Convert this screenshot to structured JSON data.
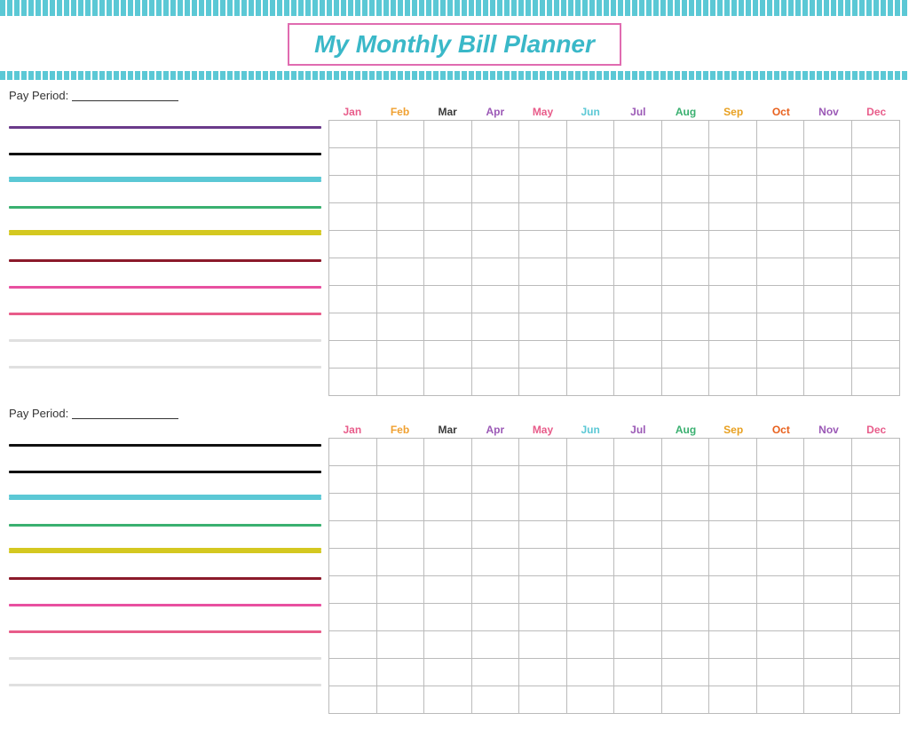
{
  "title": "My Monthly Bill Planner",
  "topBar": {
    "color": "#5bc8d5"
  },
  "months": [
    {
      "label": "Jan",
      "class": "m-jan"
    },
    {
      "label": "Feb",
      "class": "m-feb"
    },
    {
      "label": "Mar",
      "class": "m-mar"
    },
    {
      "label": "Apr",
      "class": "m-apr"
    },
    {
      "label": "May",
      "class": "m-may"
    },
    {
      "label": "Jun",
      "class": "m-jun"
    },
    {
      "label": "Jul",
      "class": "m-jul"
    },
    {
      "label": "Aug",
      "class": "m-aug"
    },
    {
      "label": "Sep",
      "class": "m-sep"
    },
    {
      "label": "Oct",
      "class": "m-oct"
    },
    {
      "label": "Nov",
      "class": "m-nov"
    },
    {
      "label": "Dec",
      "class": "m-dec"
    }
  ],
  "section1": {
    "payPeriodLabel": "Pay Period:",
    "rows": 10,
    "lineColors": [
      [
        "#6a3a8a"
      ],
      [
        "#111"
      ],
      [
        "#5bc8d5",
        "#5bc8d5"
      ],
      [
        "#3ab070"
      ],
      [
        "#d4c820",
        "#d4c820"
      ],
      [
        "#8b1a2a"
      ],
      [
        "#e850a0"
      ],
      [
        "#e85c8a"
      ],
      [
        "#e0e0e0"
      ],
      [
        "#e0e0e0"
      ]
    ]
  },
  "section2": {
    "payPeriodLabel": "Pay Period:",
    "rows": 10,
    "lineColors": [
      [
        "#111"
      ],
      [
        "#111"
      ],
      [
        "#5bc8d5",
        "#5bc8d5"
      ],
      [
        "#3ab070"
      ],
      [
        "#d4c820",
        "#d4c820"
      ],
      [
        "#8b1a2a"
      ],
      [
        "#e850a0"
      ],
      [
        "#e85c8a"
      ],
      [
        "#e0e0e0"
      ],
      [
        "#e0e0e0"
      ]
    ]
  }
}
